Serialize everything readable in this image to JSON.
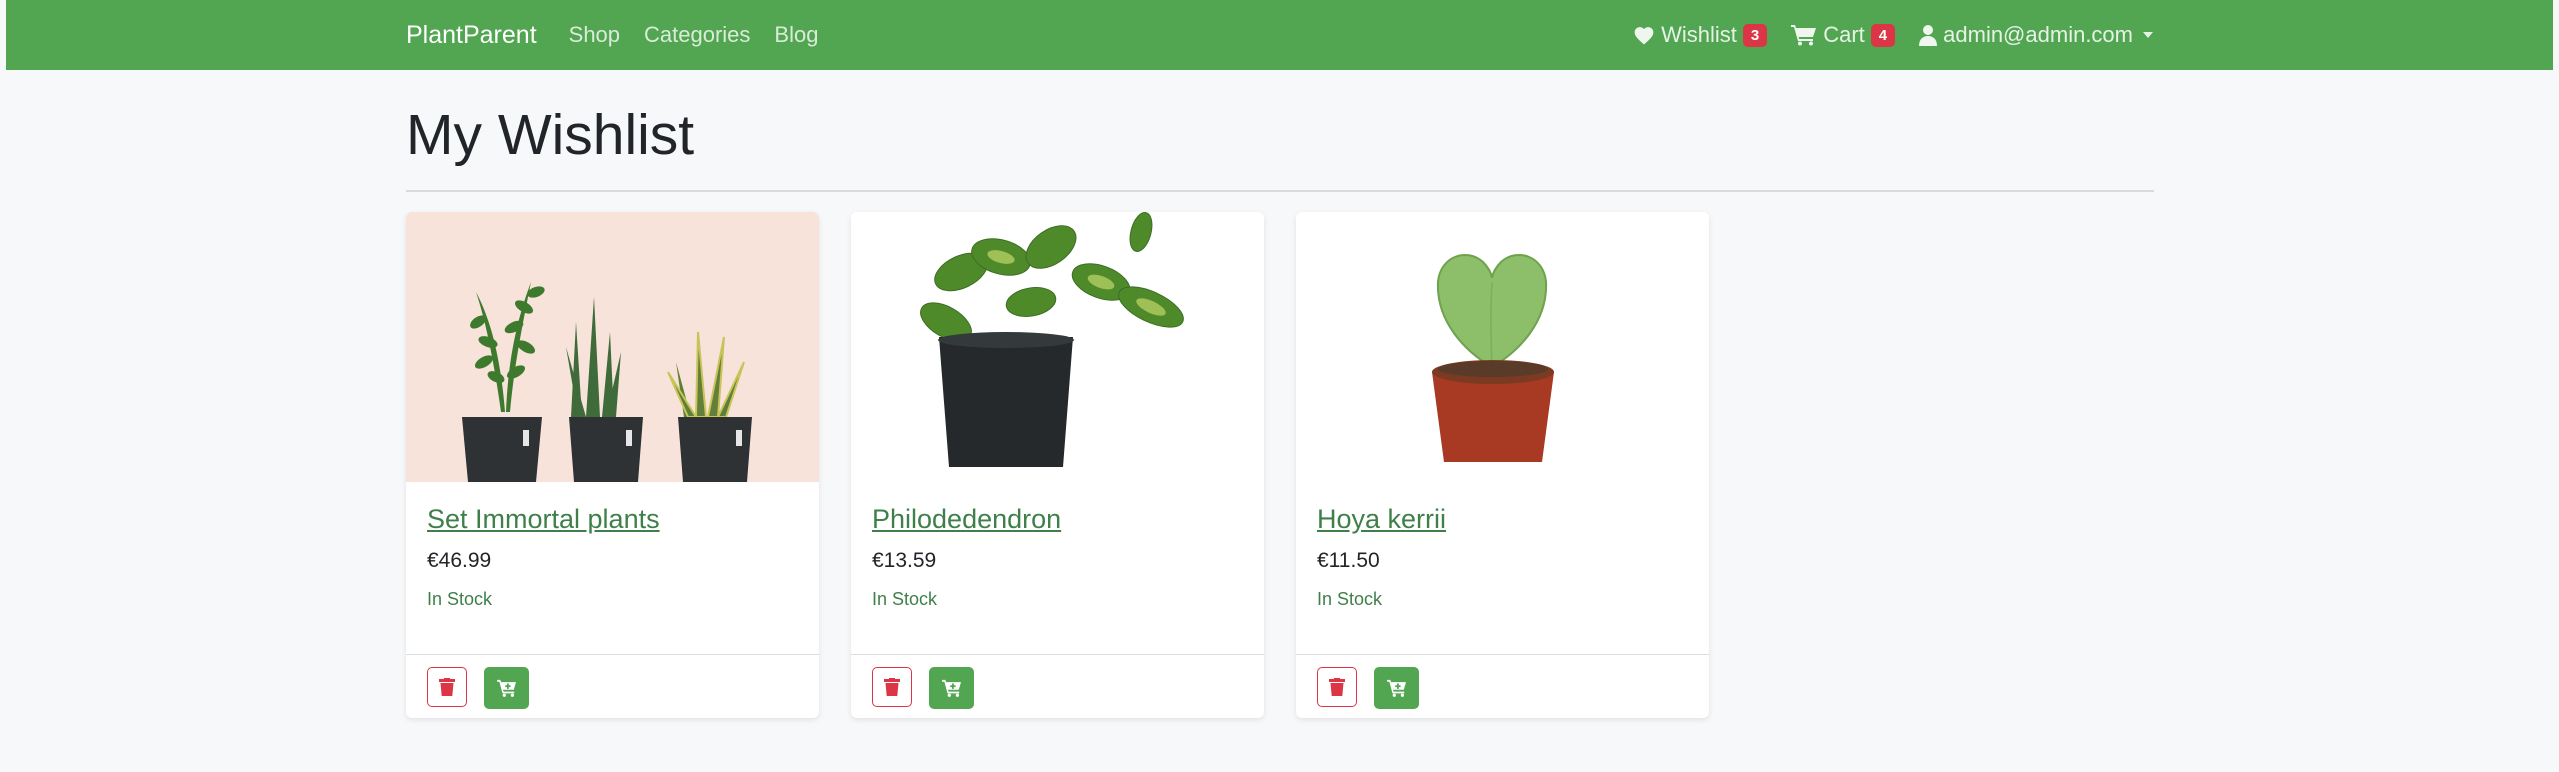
{
  "nav": {
    "brand": "PlantParent",
    "links": [
      "Shop",
      "Categories",
      "Blog"
    ],
    "wishlist_label": "Wishlist",
    "wishlist_count": "3",
    "cart_label": "Cart",
    "cart_count": "4",
    "user_label": "admin@admin.com"
  },
  "page": {
    "title": "My Wishlist"
  },
  "items": [
    {
      "name": "Set Immortal plants",
      "price": "€46.99",
      "stock": "In Stock"
    },
    {
      "name": "Philodedendron",
      "price": "€13.59",
      "stock": "In Stock"
    },
    {
      "name": "Hoya kerrii",
      "price": "€11.50",
      "stock": "In Stock"
    }
  ],
  "icons": {
    "wishlist": "heart-icon",
    "cart": "cart-icon",
    "user": "user-icon",
    "remove": "trash-icon",
    "add_to_cart": "cart-plus-icon"
  },
  "colors": {
    "navbar": "#52a651",
    "link": "#3f7f4a",
    "danger": "#dc3545",
    "background": "#f7f8fa"
  }
}
